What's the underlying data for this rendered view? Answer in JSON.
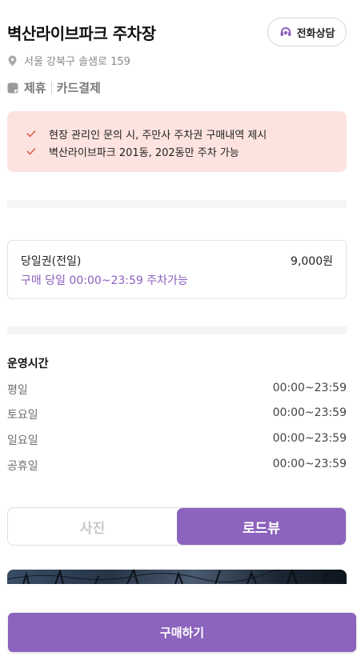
{
  "header": {
    "title": "벽산라이브파크 주차장",
    "call_button_label": "전화상담"
  },
  "address": "서울 강북구 솔샘로 159",
  "tags": [
    "제휴",
    "카드결제"
  ],
  "notice": {
    "items": [
      "현장 관리인 문의 시, 주만사 주차권 구매내역 제시",
      "벽산라이브파크 201동, 202동만 주차 가능"
    ]
  },
  "ticket": {
    "name": "당일권(전일)",
    "price": "9,000원",
    "description": "구매 당일 00:00~23:59 주차가능"
  },
  "hours": {
    "title": "운영시간",
    "rows": [
      {
        "day": "평일",
        "time": "00:00~23:59"
      },
      {
        "day": "토요일",
        "time": "00:00~23:59"
      },
      {
        "day": "일요일",
        "time": "00:00~23:59"
      },
      {
        "day": "공휴일",
        "time": "00:00~23:59"
      }
    ]
  },
  "view_toggle": {
    "photo_label": "사진",
    "roadview_label": "로드뷰",
    "selected": "로드뷰"
  },
  "buy_button_label": "구매하기",
  "colors": {
    "accent": "#8c63bd",
    "notice_bg": "#fde3df",
    "check": "#e0604f"
  }
}
